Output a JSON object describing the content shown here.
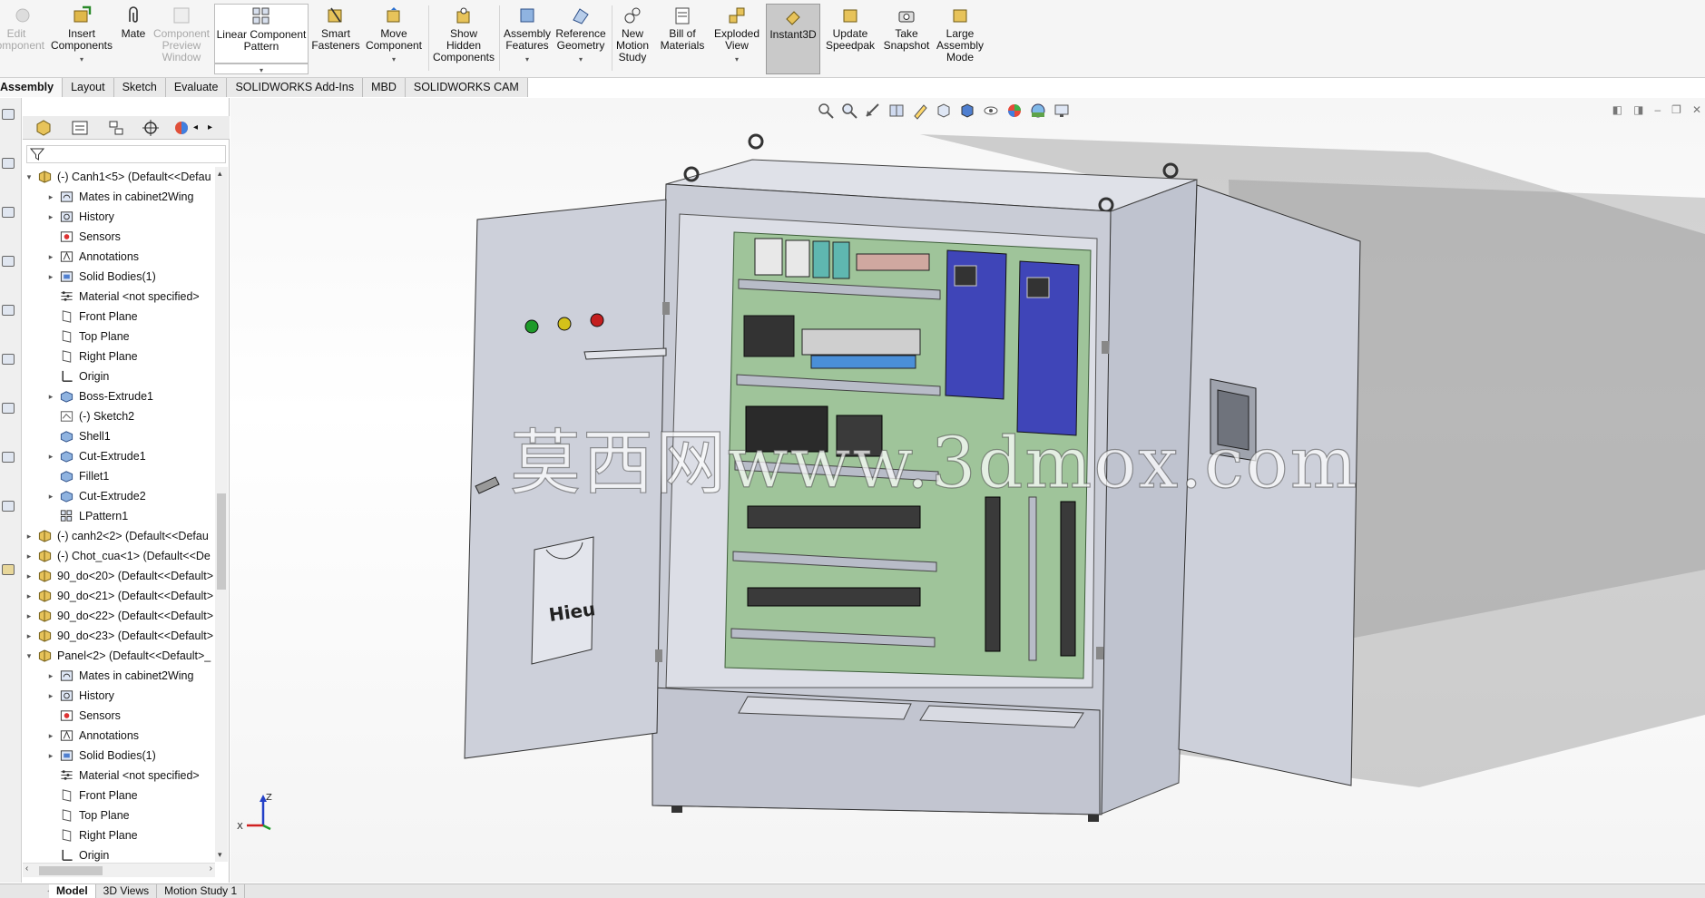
{
  "ribbon": {
    "edit_component": "Edit\nComponent",
    "insert_components": "Insert\nComponents",
    "mate": "Mate",
    "component_preview_window": "Component\nPreview\nWindow",
    "linear_component_pattern": "Linear Component\nPattern",
    "smart_fasteners": "Smart\nFasteners",
    "move_component": "Move\nComponent",
    "show_hidden_components": "Show\nHidden\nComponents",
    "assembly_features": "Assembly\nFeatures",
    "reference_geometry": "Reference\nGeometry",
    "new_motion_study": "New\nMotion\nStudy",
    "bill_of_materials": "Bill of\nMaterials",
    "exploded_view": "Exploded\nView",
    "instant3d": "Instant3D",
    "update_speedpak": "Update\nSpeedpak",
    "take_snapshot": "Take\nSnapshot",
    "large_assembly_mode": "Large\nAssembly\nMode"
  },
  "command_tabs": [
    "Assembly",
    "Layout",
    "Sketch",
    "Evaluate",
    "SOLIDWORKS Add-Ins",
    "MBD",
    "SOLIDWORKS CAM"
  ],
  "tree": [
    {
      "level": 0,
      "expand": "▾",
      "icon": "assembly",
      "label": "(-) Canh1<5> (Default<<Defau"
    },
    {
      "level": 1,
      "expand": "▸",
      "icon": "mates",
      "label": "Mates in cabinet2Wing"
    },
    {
      "level": 1,
      "expand": "▸",
      "icon": "history",
      "label": "History"
    },
    {
      "level": 1,
      "expand": "",
      "icon": "sensor",
      "label": "Sensors"
    },
    {
      "level": 1,
      "expand": "▸",
      "icon": "annotation",
      "label": "Annotations"
    },
    {
      "level": 1,
      "expand": "▸",
      "icon": "solid",
      "label": "Solid Bodies(1)"
    },
    {
      "level": 1,
      "expand": "",
      "icon": "material",
      "label": "Material <not specified>"
    },
    {
      "level": 1,
      "expand": "",
      "icon": "plane",
      "label": "Front Plane"
    },
    {
      "level": 1,
      "expand": "",
      "icon": "plane",
      "label": "Top Plane"
    },
    {
      "level": 1,
      "expand": "",
      "icon": "plane",
      "label": "Right Plane"
    },
    {
      "level": 1,
      "expand": "",
      "icon": "origin",
      "label": "Origin"
    },
    {
      "level": 1,
      "expand": "▸",
      "icon": "feature",
      "label": "Boss-Extrude1"
    },
    {
      "level": 1,
      "expand": "",
      "icon": "sketch",
      "label": "(-) Sketch2"
    },
    {
      "level": 1,
      "expand": "",
      "icon": "feature",
      "label": "Shell1"
    },
    {
      "level": 1,
      "expand": "▸",
      "icon": "feature",
      "label": "Cut-Extrude1"
    },
    {
      "level": 1,
      "expand": "",
      "icon": "feature",
      "label": "Fillet1"
    },
    {
      "level": 1,
      "expand": "▸",
      "icon": "feature",
      "label": "Cut-Extrude2"
    },
    {
      "level": 1,
      "expand": "",
      "icon": "pattern",
      "label": "LPattern1"
    },
    {
      "level": 0,
      "expand": "▸",
      "icon": "assembly",
      "label": "(-) canh2<2> (Default<<Defau"
    },
    {
      "level": 0,
      "expand": "▸",
      "icon": "assembly",
      "label": "(-) Chot_cua<1> (Default<<De"
    },
    {
      "level": 0,
      "expand": "▸",
      "icon": "assembly",
      "label": "90_do<20> (Default<<Default>"
    },
    {
      "level": 0,
      "expand": "▸",
      "icon": "assembly",
      "label": "90_do<21> (Default<<Default>"
    },
    {
      "level": 0,
      "expand": "▸",
      "icon": "assembly",
      "label": "90_do<22> (Default<<Default>"
    },
    {
      "level": 0,
      "expand": "▸",
      "icon": "assembly",
      "label": "90_do<23> (Default<<Default>"
    },
    {
      "level": 0,
      "expand": "▾",
      "icon": "assembly",
      "label": "Panel<2> (Default<<Default>_"
    },
    {
      "level": 1,
      "expand": "▸",
      "icon": "mates",
      "label": "Mates in cabinet2Wing"
    },
    {
      "level": 1,
      "expand": "▸",
      "icon": "history",
      "label": "History"
    },
    {
      "level": 1,
      "expand": "",
      "icon": "sensor",
      "label": "Sensors"
    },
    {
      "level": 1,
      "expand": "▸",
      "icon": "annotation",
      "label": "Annotations"
    },
    {
      "level": 1,
      "expand": "▸",
      "icon": "solid",
      "label": "Solid Bodies(1)"
    },
    {
      "level": 1,
      "expand": "",
      "icon": "material",
      "label": "Material <not specified>"
    },
    {
      "level": 1,
      "expand": "",
      "icon": "plane",
      "label": "Front Plane"
    },
    {
      "level": 1,
      "expand": "",
      "icon": "plane",
      "label": "Top Plane"
    },
    {
      "level": 1,
      "expand": "",
      "icon": "plane",
      "label": "Right Plane"
    },
    {
      "level": 1,
      "expand": "",
      "icon": "origin",
      "label": "Origin"
    }
  ],
  "viewport": {
    "watermark": "莫西网www.3dmox.com",
    "door_label": "Hieu",
    "triad_z": "Z",
    "triad_x": "X"
  },
  "bottom_tabs": [
    "Model",
    "3D Views",
    "Motion Study 1"
  ],
  "colors": {
    "panel_green": "#9fc49a",
    "cabinet_gray": "#cdd0da",
    "vfd_blue": "#3f45b8",
    "button_green": "#1e9a2a",
    "button_yellow": "#d4c21a",
    "button_red": "#c41e1e"
  }
}
